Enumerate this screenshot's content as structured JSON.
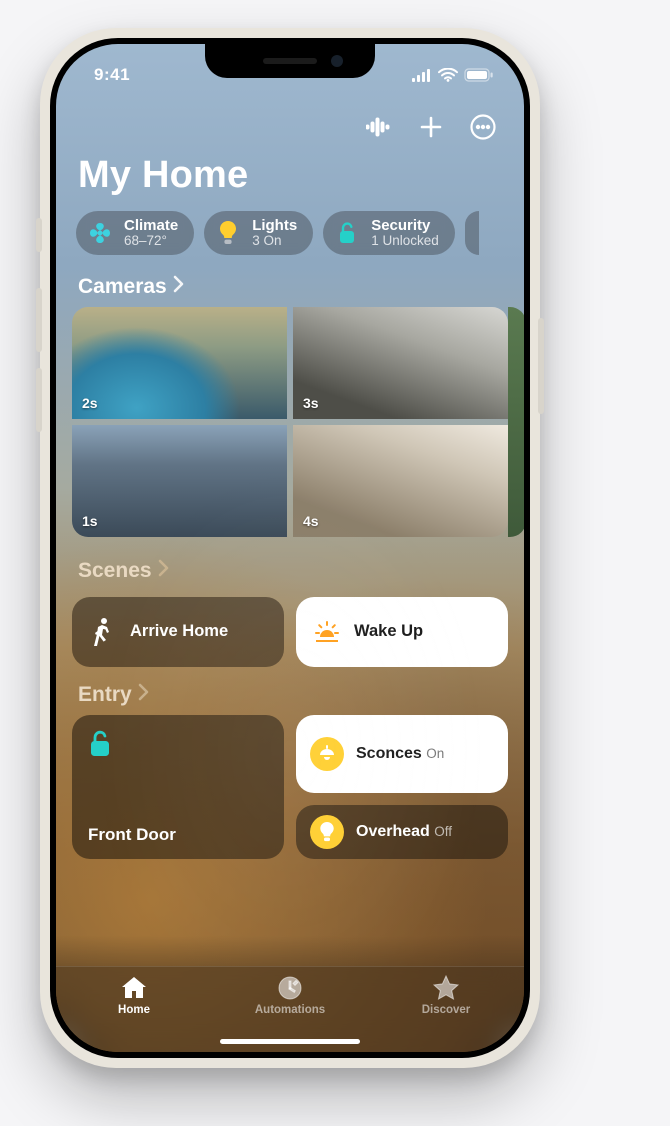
{
  "status": {
    "time": "9:41"
  },
  "header": {
    "title": "My Home"
  },
  "chips": {
    "climate": {
      "label": "Climate",
      "sub": "68–72°"
    },
    "lights": {
      "label": "Lights",
      "sub": "3 On"
    },
    "security": {
      "label": "Security",
      "sub": "1 Unlocked"
    }
  },
  "sections": {
    "cameras": {
      "title": "Cameras"
    },
    "scenes": {
      "title": "Scenes"
    },
    "entry": {
      "title": "Entry"
    }
  },
  "cameras": [
    {
      "ts": "2s"
    },
    {
      "ts": "3s"
    },
    {
      "ts": "1s"
    },
    {
      "ts": "4s"
    }
  ],
  "scenes": {
    "arrive": {
      "label": "Arrive Home"
    },
    "wake": {
      "label": "Wake Up"
    }
  },
  "entry": {
    "front_door": {
      "label": "Front Door"
    },
    "sconces": {
      "label": "Sconces",
      "sub": "On"
    },
    "overhead": {
      "label": "Overhead",
      "sub": "Off"
    }
  },
  "tabs": {
    "home": "Home",
    "automations": "Automations",
    "discover": "Discover"
  }
}
